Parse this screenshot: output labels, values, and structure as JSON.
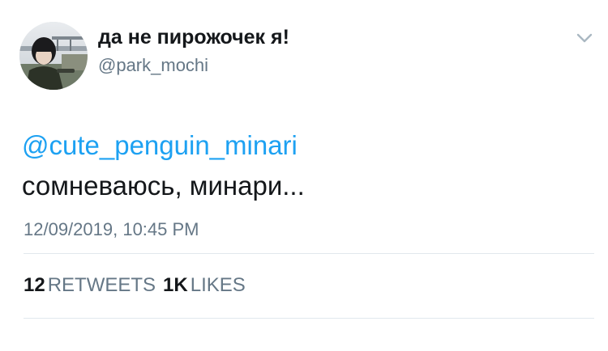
{
  "tweet": {
    "display_name": "да не пирожочек я!",
    "handle": "@park_mochi",
    "avatar_icon": "user-photo-avatar",
    "menu_icon": "chevron-down-icon",
    "mention": "@cute_penguin_minari",
    "text": "сомневаюсь, минари...",
    "timestamp": "12/09/2019, 10:45 PM",
    "stats": {
      "retweets_count": "12",
      "retweets_label": "RETWEETS",
      "likes_count": "1K",
      "likes_label": "LIKES"
    }
  },
  "colors": {
    "link": "#1da1f2",
    "secondary_text": "#657786",
    "primary_text": "#14171a",
    "divider": "#e1e8ed"
  }
}
